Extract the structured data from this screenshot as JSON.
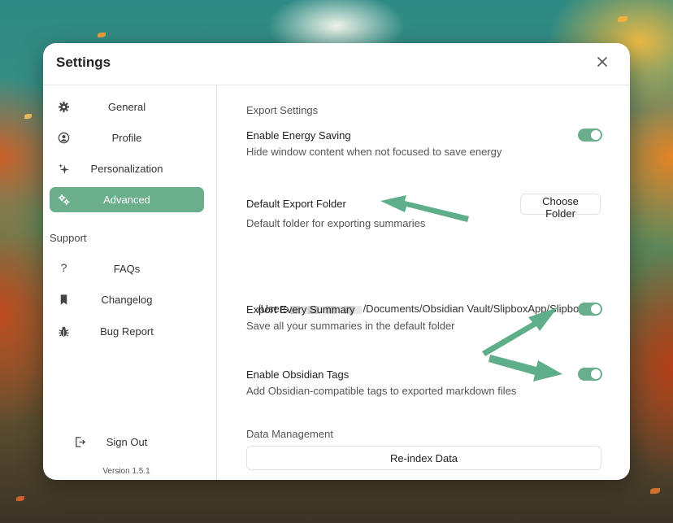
{
  "dialog": {
    "title": "Settings"
  },
  "sidebar": {
    "items": [
      {
        "label": "General",
        "icon": "gear-icon",
        "active": false
      },
      {
        "label": "Profile",
        "icon": "user-circle-icon",
        "active": false
      },
      {
        "label": "Personalization",
        "icon": "sparkle-icon",
        "active": false
      },
      {
        "label": "Advanced",
        "icon": "gears-icon",
        "active": true
      }
    ],
    "support_label": "Support",
    "support_items": [
      {
        "label": "FAQs",
        "icon": "question-icon"
      },
      {
        "label": "Changelog",
        "icon": "bookmark-icon"
      },
      {
        "label": "Bug Report",
        "icon": "bug-icon"
      }
    ],
    "sign_out": {
      "label": "Sign Out",
      "icon": "sign-out-icon"
    },
    "version": "Version 1.5.1"
  },
  "main": {
    "export_settings_heading": "Export Settings",
    "energy_saving": {
      "title": "Enable Energy Saving",
      "description": "Hide window content when not focused to save energy",
      "enabled": true
    },
    "default_folder": {
      "title": "Default Export Folder",
      "description": "Default folder for exporting summaries",
      "button_label": "Choose Folder",
      "path_prefix": "/Users",
      "path_suffix": "/Documents/Obsidian Vault/SlipboxApp/Slipbox"
    },
    "export_every_summary": {
      "title": "Export Every Summary",
      "description": "Save all your summaries in the default folder",
      "enabled": true
    },
    "obsidian_tags": {
      "title": "Enable Obsidian Tags",
      "description": "Add Obsidian-compatible tags to exported markdown files",
      "enabled": true
    },
    "data_management_heading": "Data Management",
    "reindex_button_label": "Re-index Data"
  },
  "colors": {
    "accent": "#6aae8c",
    "annotation_arrow": "#5fae8a"
  }
}
